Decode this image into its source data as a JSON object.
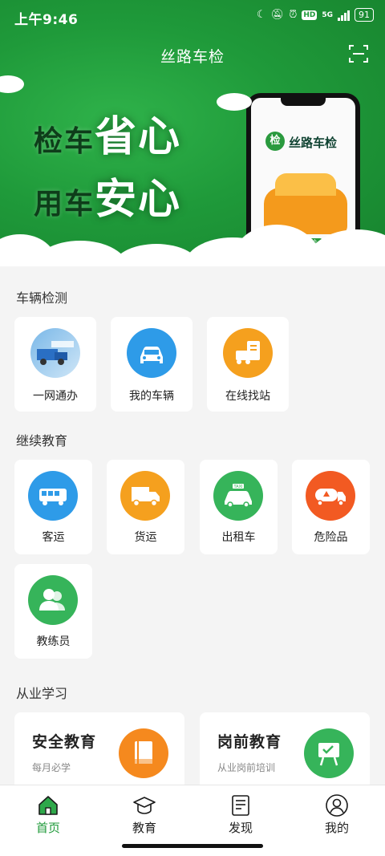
{
  "status": {
    "time": "上午9:46",
    "network": "5G",
    "hd": "HD",
    "battery": "91"
  },
  "header": {
    "title": "丝路车检"
  },
  "banner": {
    "line1_small": "检车",
    "line1_big": "省心",
    "line2_small": "用车",
    "line2_big": "安心",
    "phone_logo": "检",
    "phone_brand": "丝路车检",
    "phone_plate": "丝路车检"
  },
  "vehicle_inspection": {
    "title": "车辆检测",
    "items": [
      {
        "label": "一网通办",
        "icon": "portal-image-icon"
      },
      {
        "label": "我的车辆",
        "icon": "car-icon"
      },
      {
        "label": "在线找站",
        "icon": "station-search-icon"
      }
    ]
  },
  "continuing_education": {
    "title": "继续教育",
    "items": [
      {
        "label": "客运",
        "icon": "bus-icon",
        "color": "#2e9be8"
      },
      {
        "label": "货运",
        "icon": "truck-icon",
        "color": "#f5a01e"
      },
      {
        "label": "出租车",
        "icon": "taxi-icon",
        "color": "#36b45a"
      },
      {
        "label": "危险品",
        "icon": "tanker-icon",
        "color": "#f25a22"
      },
      {
        "label": "教练员",
        "icon": "instructor-icon",
        "color": "#36b45a"
      }
    ]
  },
  "professional_learning": {
    "title": "从业学习",
    "items": [
      {
        "title": "安全教育",
        "subtitle": "每月必学",
        "icon": "book-icon",
        "color": "#f5891e"
      },
      {
        "title": "岗前教育",
        "subtitle": "从业岗前培训",
        "icon": "whiteboard-icon",
        "color": "#36b45a"
      }
    ]
  },
  "bottom_nav": {
    "items": [
      {
        "label": "首页",
        "icon": "home-icon",
        "active": true
      },
      {
        "label": "教育",
        "icon": "graduation-cap-icon",
        "active": false
      },
      {
        "label": "发现",
        "icon": "news-icon",
        "active": false
      },
      {
        "label": "我的",
        "icon": "profile-icon",
        "active": false
      }
    ]
  },
  "colors": {
    "brand": "#1f9a3a",
    "background": "#f4f4f4"
  }
}
